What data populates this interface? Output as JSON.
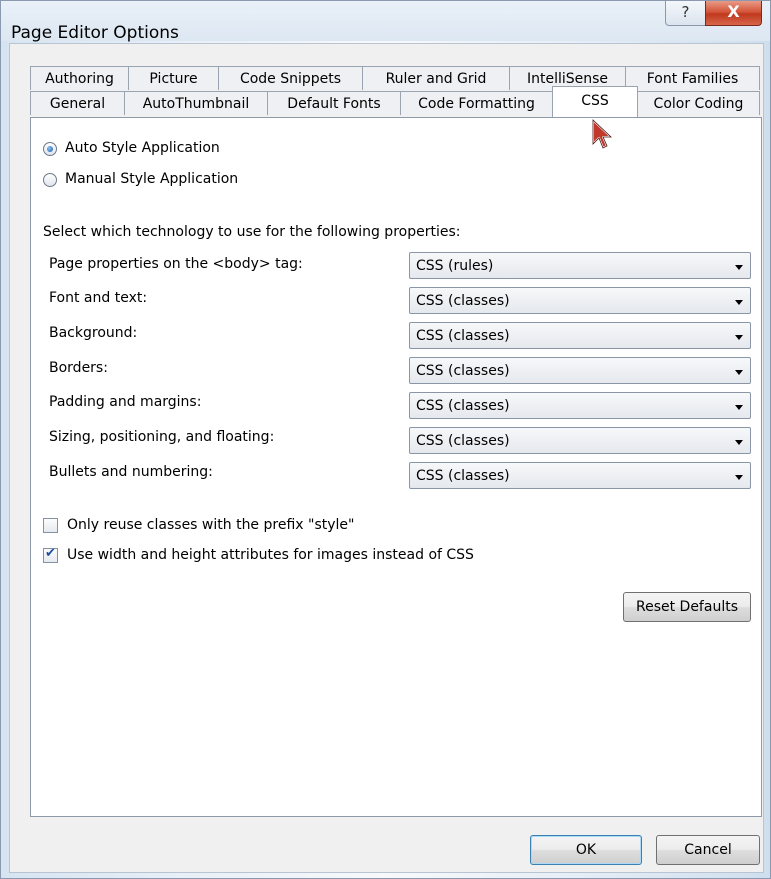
{
  "window": {
    "title": "Page Editor Options",
    "help_glyph": "?",
    "close_glyph": "X"
  },
  "tabs": {
    "row_top": [
      "Authoring",
      "Picture",
      "Code Snippets",
      "Ruler and Grid",
      "IntelliSense",
      "Font Families"
    ],
    "row_bottom": [
      "General",
      "AutoThumbnail",
      "Default Fonts",
      "Code Formatting",
      "CSS",
      "Color Coding"
    ],
    "active": "CSS"
  },
  "style_application": {
    "auto_label": "Auto Style Application",
    "manual_label": "Manual Style Application",
    "selected": "auto"
  },
  "technology_heading": "Select which technology to use for the following properties:",
  "properties": [
    {
      "label": "Page properties on the <body> tag:",
      "value": "CSS (rules)"
    },
    {
      "label": "Font and text:",
      "value": "CSS (classes)"
    },
    {
      "label": "Background:",
      "value": "CSS (classes)"
    },
    {
      "label": "Borders:",
      "value": "CSS (classes)"
    },
    {
      "label": "Padding and margins:",
      "value": "CSS (classes)"
    },
    {
      "label": "Sizing, positioning, and floating:",
      "value": "CSS (classes)"
    },
    {
      "label": "Bullets and numbering:",
      "value": "CSS (classes)"
    }
  ],
  "options": {
    "reuse_prefix": {
      "label": "Only reuse classes with the prefix \"style\"",
      "checked": false
    },
    "use_width_height": {
      "label": "Use width and height attributes for images instead of CSS",
      "checked": true
    }
  },
  "buttons": {
    "reset": "Reset Defaults",
    "ok": "OK",
    "cancel": "Cancel"
  },
  "colors": {
    "accent": "#1a5fb0",
    "close_button": "#c0391e",
    "cursor": "#c0392b"
  }
}
